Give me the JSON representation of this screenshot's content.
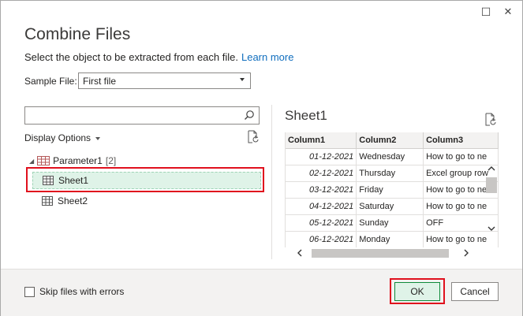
{
  "window": {
    "maximize_glyph": "☐",
    "close_glyph": "✕"
  },
  "dialog": {
    "title": "Combine Files",
    "subtitle": "Select the object to be extracted from each file.",
    "learn_more": "Learn more"
  },
  "sample_file": {
    "label": "Sample File:",
    "value": "First file"
  },
  "navigator": {
    "search_placeholder": "",
    "display_options": "Display Options",
    "parameter": {
      "name": "Parameter1",
      "count": "[2]"
    },
    "sheets": [
      "Sheet1",
      "Sheet2"
    ],
    "selected": "Sheet1"
  },
  "preview": {
    "title": "Sheet1",
    "columns": [
      "Column1",
      "Column2",
      "Column3"
    ],
    "rows": [
      [
        "01-12-2021",
        "Wednesday",
        "How to go to ne"
      ],
      [
        "02-12-2021",
        "Thursday",
        "Excel group row"
      ],
      [
        "03-12-2021",
        "Friday",
        "How to go to ne"
      ],
      [
        "04-12-2021",
        "Saturday",
        "How to go to ne"
      ],
      [
        "05-12-2021",
        "Sunday",
        "OFF"
      ],
      [
        "06-12-2021",
        "Monday",
        "How to go to ne"
      ]
    ]
  },
  "footer": {
    "skip_label": "Skip files with errors",
    "skip_checked": false,
    "ok": "OK",
    "cancel": "Cancel"
  },
  "colors": {
    "highlight_red": "#e0101d",
    "selection_green": "#dff3e8",
    "link_blue": "#106ebe"
  }
}
